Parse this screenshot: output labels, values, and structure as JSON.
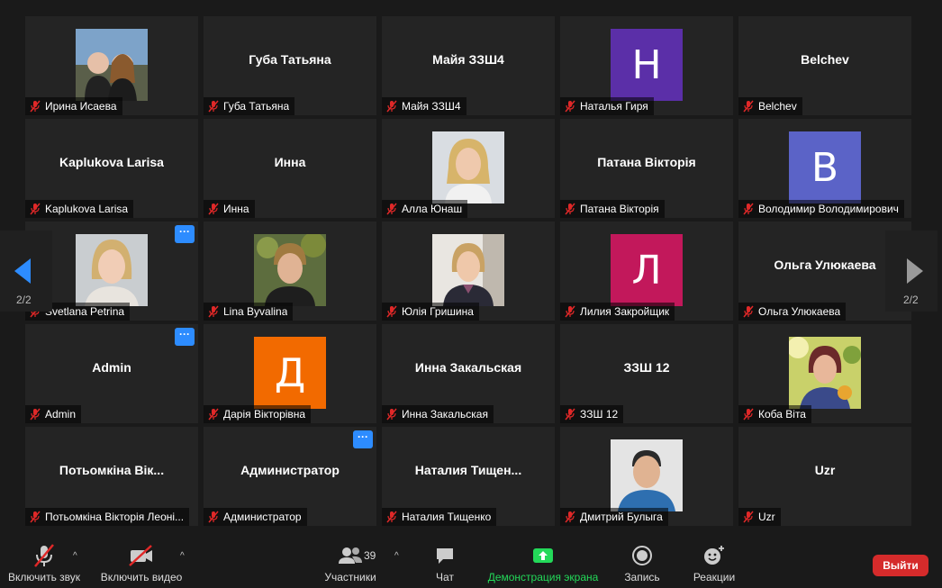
{
  "gallery": {
    "tiles": [
      {
        "name": "Ирина Исаева",
        "title": "",
        "type": "photo",
        "photo": "photo-1"
      },
      {
        "name": "Губа Татьяна",
        "title": "Губа Татьяна",
        "type": "text"
      },
      {
        "name": "Майя ЗЗШ4",
        "title": "Майя ЗЗШ4",
        "type": "text"
      },
      {
        "name": "Наталья Гиря",
        "title": "",
        "type": "letter",
        "letter": "Н",
        "color": "#5b2fa8"
      },
      {
        "name": "Belchev",
        "title": "Belchev",
        "type": "text"
      },
      {
        "name": "Kaplukova Larisa",
        "title": "Kaplukova Larisa",
        "type": "text"
      },
      {
        "name": "Инна",
        "title": "Инна",
        "type": "text"
      },
      {
        "name": "Алла Юнаш",
        "title": "",
        "type": "photo",
        "photo": "photo-2"
      },
      {
        "name": "Патана Вікторія",
        "title": "Патана Вікторія",
        "type": "text"
      },
      {
        "name": "Володимир Володимирович",
        "title": "",
        "type": "letter",
        "letter": "В",
        "color": "#5b63c7"
      },
      {
        "name": "Svetlana Petrina",
        "title": "",
        "type": "photo",
        "photo": "photo-3",
        "more": true
      },
      {
        "name": "Lina Byvalina",
        "title": "",
        "type": "photo",
        "photo": "photo-4"
      },
      {
        "name": "Юлія Гришина",
        "title": "",
        "type": "photo",
        "photo": "photo-5"
      },
      {
        "name": "Лилия Закройщик",
        "title": "",
        "type": "letter",
        "letter": "Л",
        "color": "#c2185b"
      },
      {
        "name": "Ольга Улюкаева",
        "title": "Ольга Улюкаева",
        "type": "text"
      },
      {
        "name": "Admin",
        "title": "Admin",
        "type": "text",
        "more": true
      },
      {
        "name": "Дарія Вікторівна",
        "title": "",
        "type": "letter",
        "letter": "Д",
        "color": "#f26a00"
      },
      {
        "name": "Инна Закальская",
        "title": "Инна Закальская",
        "type": "text"
      },
      {
        "name": "ЗЗШ 12",
        "title": "ЗЗШ 12",
        "type": "text"
      },
      {
        "name": "Коба Віта",
        "title": "",
        "type": "photo",
        "photo": "photo-6"
      },
      {
        "name": "Потьомкіна Вікторія Леоні...",
        "title": "Потьомкіна Вік...",
        "type": "text"
      },
      {
        "name": "Администратор",
        "title": "Администратор",
        "type": "text",
        "more": true
      },
      {
        "name": "Наталия Тищенко",
        "title": "Наталия  Тищен...",
        "type": "text"
      },
      {
        "name": "Дмитрий Булыга",
        "title": "",
        "type": "photo",
        "photo": "photo-7"
      },
      {
        "name": "Uzr",
        "title": "Uzr",
        "type": "text"
      }
    ],
    "more_label": "···",
    "pager_left": "2/2",
    "pager_right": "2/2"
  },
  "toolbar": {
    "mute_label": "Включить звук",
    "video_label": "Включить видео",
    "participants_label": "Участники",
    "participants_count": "39",
    "chat_label": "Чат",
    "share_label": "Демонстрация экрана",
    "record_label": "Запись",
    "reactions_label": "Реакции",
    "leave_label": "Выйти",
    "caret": "^"
  },
  "colors": {
    "background": "#1a1a1a",
    "tile": "#242424",
    "accent": "#2d8cff",
    "share_green": "#23d959",
    "leave_red": "#d52b2b",
    "muted_red": "#e02828"
  }
}
